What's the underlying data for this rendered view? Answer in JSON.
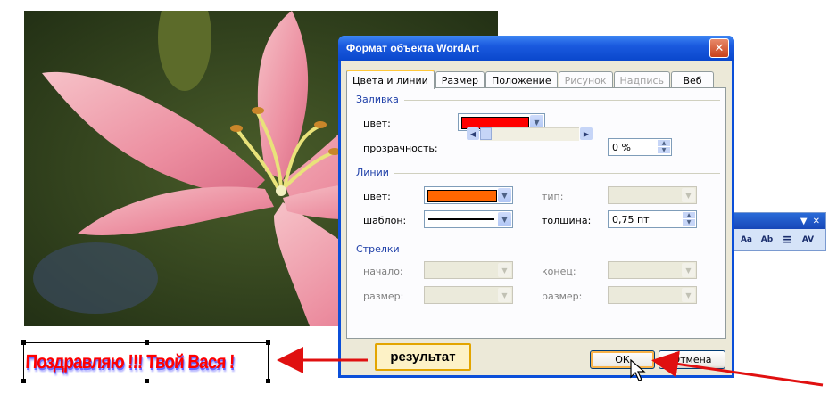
{
  "dialog": {
    "title": "Формат объекта WordArt",
    "close_glyph": "✕",
    "tabs": [
      {
        "label": "Цвета и линии",
        "active": true,
        "enabled": true
      },
      {
        "label": "Размер",
        "active": false,
        "enabled": true
      },
      {
        "label": "Положение",
        "active": false,
        "enabled": true
      },
      {
        "label": "Рисунок",
        "active": false,
        "enabled": false
      },
      {
        "label": "Надпись",
        "active": false,
        "enabled": false
      },
      {
        "label": "Веб",
        "active": false,
        "enabled": true
      }
    ],
    "fill": {
      "group_title": "Заливка",
      "color_label": "цвет:",
      "color_value": "#ff0000",
      "transparency_label": "прозрачность:",
      "transparency_value": "0 %",
      "transparency_level_percent": 0
    },
    "lines": {
      "group_title": "Линии",
      "color_label": "цвет:",
      "color_value": "#ff6600",
      "type_label": "тип:",
      "pattern_label": "шаблон:",
      "weight_label": "толщина:",
      "weight_value": "0,75 пт"
    },
    "arrows": {
      "group_title": "Стрелки",
      "start_label": "начало:",
      "end_label": "конец:",
      "start_size_label": "размер:",
      "end_size_label": "размер:"
    },
    "ok_label": "ОК",
    "cancel_label": "Отмена"
  },
  "wordart": {
    "text": "Поздравляю !!! Твой Вася !",
    "fill_color": "#ff0000",
    "shadow_color": "#6a6aff"
  },
  "callout": {
    "label": "результат",
    "border_color": "#e3a500"
  },
  "arrow_color": "#e01010",
  "toolbar": {
    "dropdown_glyph": "▼",
    "close_glyph": "✕",
    "buttons": [
      {
        "icon": "same-letter-heights-icon",
        "glyph": "Aa"
      },
      {
        "icon": "vertical-text-icon",
        "glyph": "Ab"
      },
      {
        "icon": "alignment-icon",
        "glyph": "≡"
      },
      {
        "icon": "character-spacing-icon",
        "glyph": "AV"
      }
    ]
  },
  "icons": {
    "combo_arrow": "chevron-down-icon",
    "slider_left": "arrow-left-icon",
    "slider_right": "arrow-right-icon",
    "close": "close-icon"
  }
}
